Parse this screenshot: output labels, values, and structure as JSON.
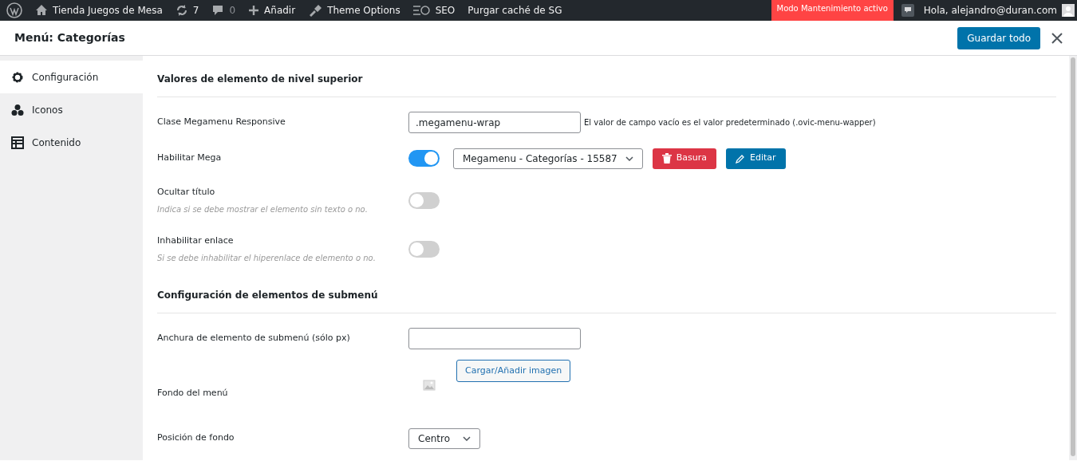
{
  "admin_bar": {
    "site": "Tienda Juegos de Mesa",
    "updates": "7",
    "comments": "0",
    "items": [
      {
        "kind": "add",
        "label": "Añadir"
      },
      {
        "kind": "brush",
        "label": "Theme Options"
      },
      {
        "kind": "seo",
        "label": "SEO"
      },
      {
        "kind": "plain",
        "label": "Purgar caché de SG"
      }
    ],
    "maintenance": "Modo Mantenimiento activo",
    "greeting": "Hola, alejandro@duran.com"
  },
  "header": {
    "title": "Menú: Categorías",
    "save": "Guardar todo"
  },
  "sidebar": {
    "items": [
      {
        "kind": "gear",
        "label": "Configuración",
        "selected": true
      },
      {
        "kind": "circles",
        "label": "Iconos",
        "selected": false
      },
      {
        "kind": "table",
        "label": "Contenido",
        "selected": false
      }
    ]
  },
  "sections": [
    {
      "heading": "Valores de elemento de nivel superior",
      "rows": [
        {
          "kind": "text",
          "label": "Clase Megamenu Responsive",
          "value": ".megamenu-wrap",
          "note": "El valor de campo vacío es el valor predeterminado (.ovic-menu-wapper)"
        },
        {
          "kind": "toggle-select",
          "label": "Habilitar Mega",
          "on": true,
          "select": "Megamenu - Categorías - 15587",
          "trash": "Basura",
          "edit": "Editar"
        },
        {
          "kind": "toggle",
          "label": "Ocultar título",
          "hint": "Indica si se debe mostrar el elemento sin texto o no.",
          "on": false
        },
        {
          "kind": "toggle",
          "label": "Inhabilitar enlace",
          "hint": "Si se debe inhabilitar el hiperenlace de elemento o no.",
          "on": false
        }
      ]
    },
    {
      "heading": "Configuración de elementos de submenú",
      "rows": [
        {
          "kind": "text",
          "label": "Anchura de elemento de submenú (sólo px)"
        },
        {
          "kind": "image",
          "label": "Fondo del menú",
          "button": "Cargar/Añadir imagen"
        },
        {
          "kind": "select",
          "label": "Posición de fondo",
          "select": "Centro"
        }
      ]
    }
  ]
}
